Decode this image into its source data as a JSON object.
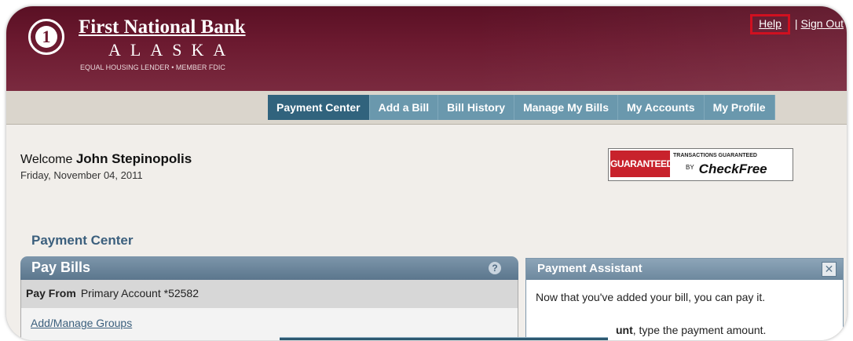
{
  "header": {
    "bank_name": "First National Bank",
    "bank_state": "ALASKA",
    "tagline": "EQUAL HOUSING LENDER • MEMBER FDIC",
    "logo_glyph": "1",
    "help_label": "Help",
    "separator": "|",
    "signout_label": "Sign Out"
  },
  "nav": {
    "tabs": [
      {
        "label": "Payment Center",
        "active": true
      },
      {
        "label": "Add a Bill",
        "active": false
      },
      {
        "label": "Bill History",
        "active": false
      },
      {
        "label": "Manage My Bills",
        "active": false
      },
      {
        "label": "My Accounts",
        "active": false
      },
      {
        "label": "My Profile",
        "active": false
      }
    ]
  },
  "welcome": {
    "prefix": "Welcome",
    "name": "John Stepinopolis",
    "date": "Friday, November 04, 2011"
  },
  "guarantee": {
    "seal": "GUARANTEED",
    "line1": "TRANSACTIONS GUARANTEED",
    "by": "BY",
    "brand": "CheckFree"
  },
  "page_title": "Payment Center",
  "pay_bills": {
    "title": "Pay Bills",
    "help_glyph": "?",
    "pay_from_label": "Pay From",
    "pay_from_value": "Primary Account *52582",
    "groups_link": "Add/Manage Groups"
  },
  "assistant": {
    "title": "Payment Assistant",
    "close_glyph": "✕",
    "message": "Now that you've added your bill, you can pay it.",
    "message2_bold": "unt",
    "message2_rest": ", type the payment amount."
  },
  "colors": {
    "header": "#6c1a30",
    "tab": "#6a98ad",
    "tab_active": "#31637d",
    "panel_bar": "#5b768d",
    "link": "#3b5f7d"
  }
}
